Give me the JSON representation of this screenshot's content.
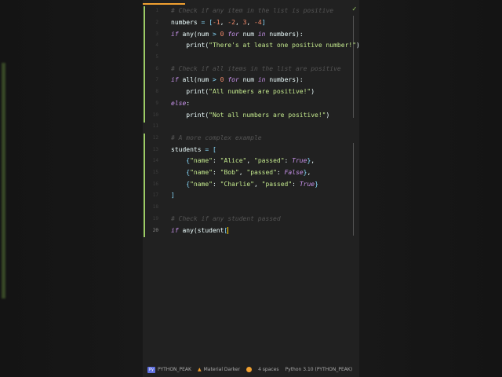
{
  "editor": {
    "lines": [
      {
        "n": "1"
      },
      {
        "n": "2"
      },
      {
        "n": "3"
      },
      {
        "n": "4"
      },
      {
        "n": "5"
      },
      {
        "n": "6"
      },
      {
        "n": "7"
      },
      {
        "n": "8"
      },
      {
        "n": "9"
      },
      {
        "n": "10"
      },
      {
        "n": "11"
      },
      {
        "n": "12"
      },
      {
        "n": "13"
      },
      {
        "n": "14"
      },
      {
        "n": "15"
      },
      {
        "n": "16"
      },
      {
        "n": "17"
      },
      {
        "n": "18"
      },
      {
        "n": "19"
      },
      {
        "n": "20"
      }
    ],
    "code": {
      "c1": "# Check if any item in the list is positive",
      "c6": "# Check if all items in the list are positive",
      "c12": "# A more complex example",
      "c19": "# Check if any student passed"
    },
    "check_icon": "✓"
  },
  "status_bar": {
    "project_badge": "Py",
    "project": "PYTHON_PEAK",
    "theme": "Material Darker",
    "indent": "4 spaces",
    "interpreter": "Python 3.10 (PYTHON_PEAK)"
  },
  "colors": {
    "accent": "#f0a030",
    "comment": "#545454",
    "keyword": "#c792ea",
    "string": "#c3e88d",
    "number": "#f78c6c"
  }
}
